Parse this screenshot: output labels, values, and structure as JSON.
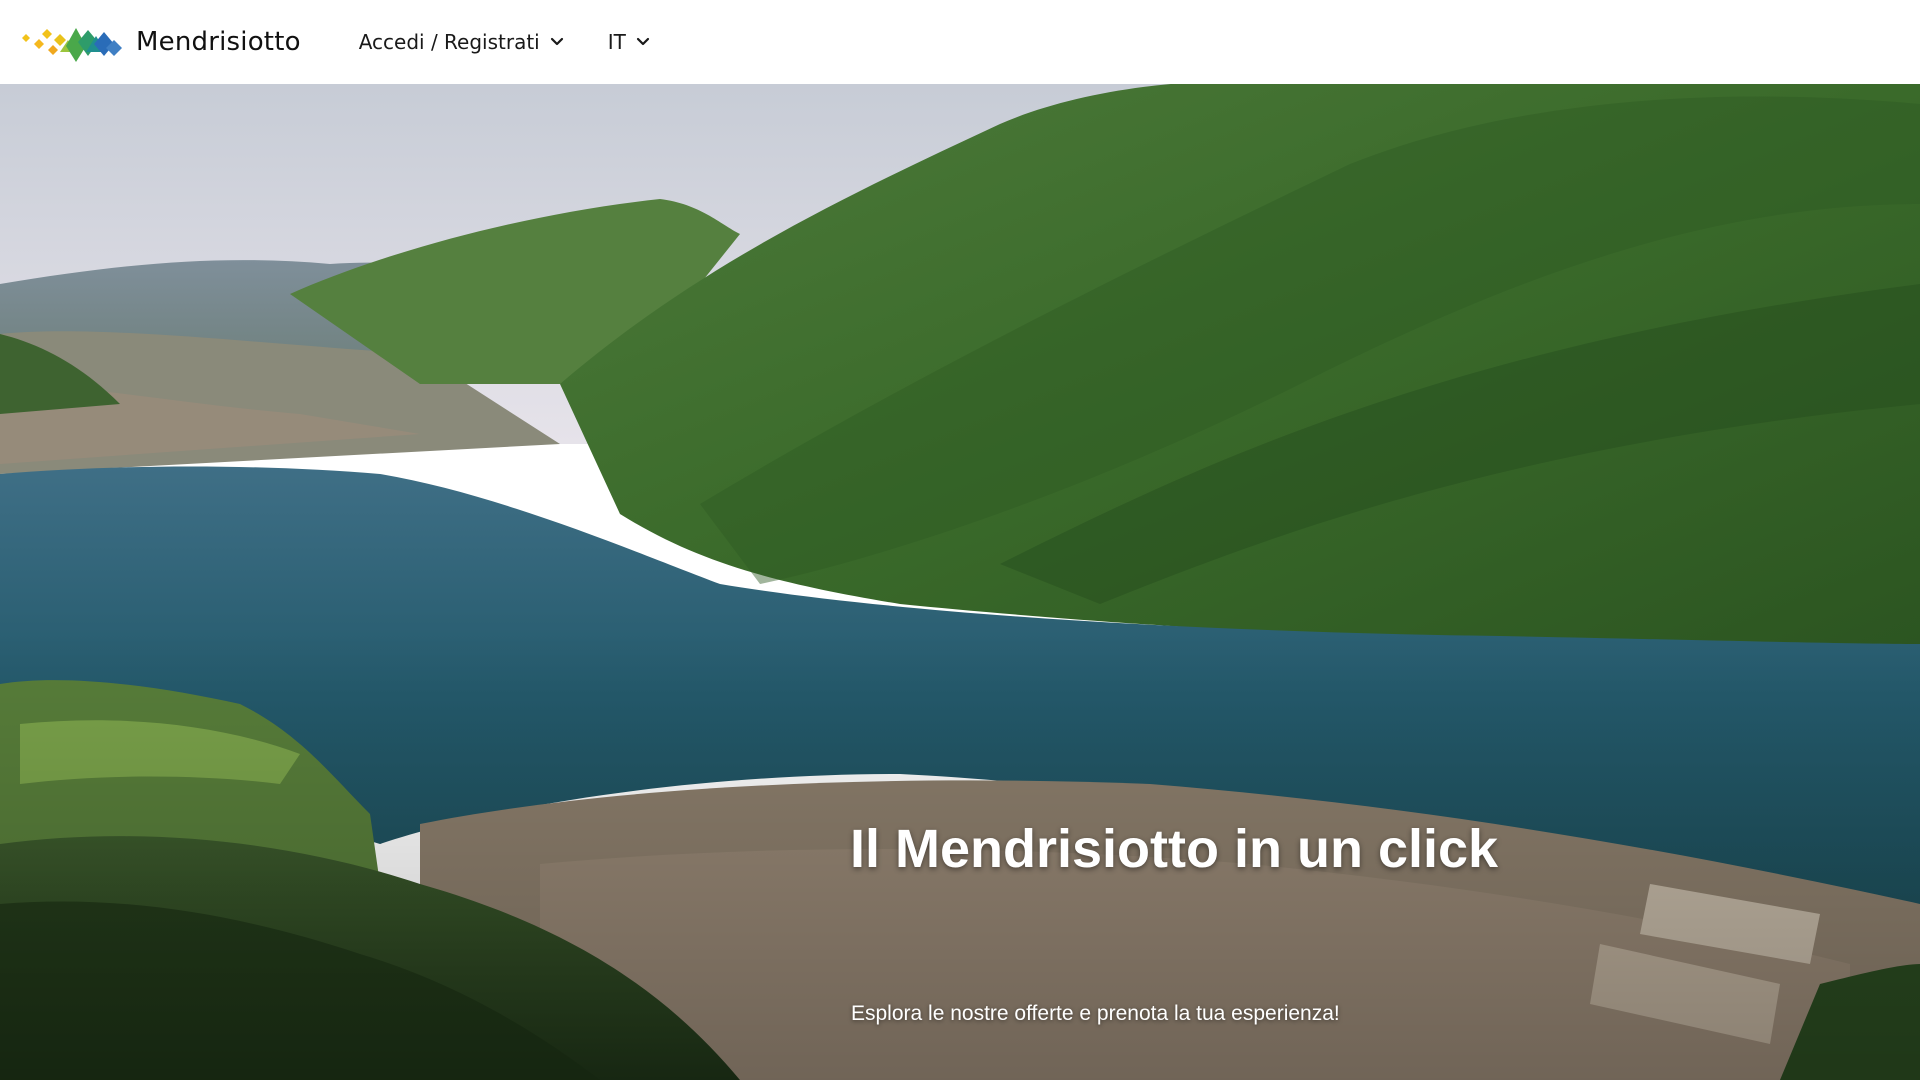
{
  "brand": {
    "name": "Mendrisiotto",
    "logo_icon": "mendrisiotto-logo-icon"
  },
  "nav": {
    "login_label": "Accedi / Registrati",
    "language_label": "IT",
    "chevron_icon": "chevron-down-icon"
  },
  "hero": {
    "title": "Il Mendrisiotto in un click",
    "subtitle": "Esplora le nostre offerte e prenota la tua esperienza!"
  },
  "colors": {
    "header_bg": "#ffffff",
    "text_dark": "#1a1a1a",
    "hero_text": "#ffffff",
    "logo_yellow": "#f2c21a",
    "logo_green": "#4aa84a",
    "logo_teal": "#1f8f8f",
    "logo_blue": "#2a6cb8"
  }
}
